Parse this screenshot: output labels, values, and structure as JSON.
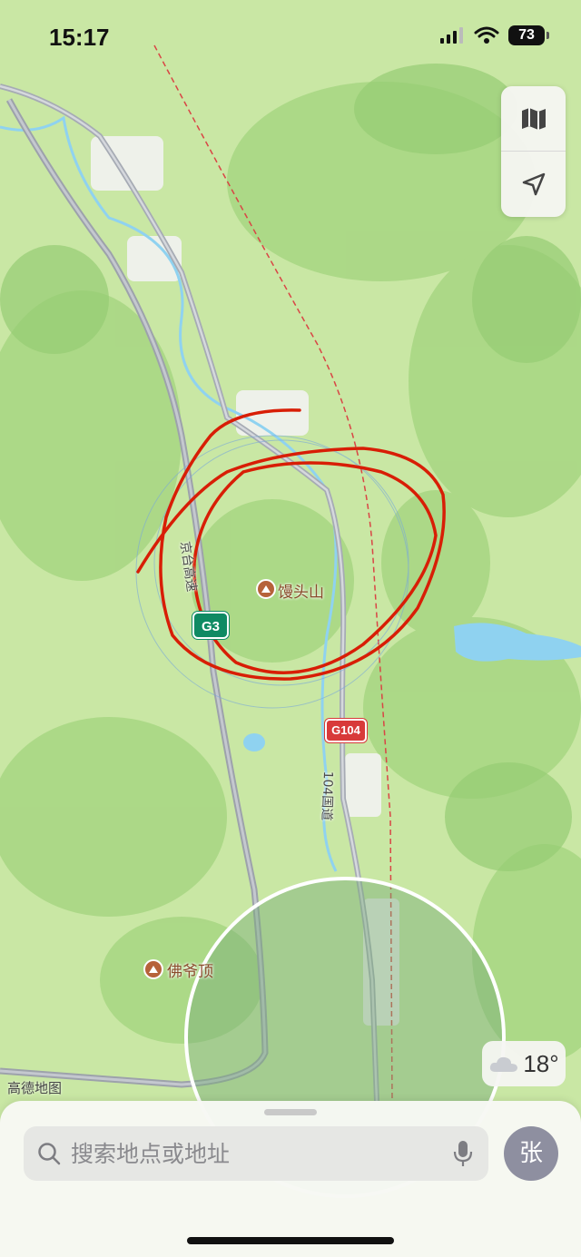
{
  "status_bar": {
    "time": "15:17",
    "battery": "73"
  },
  "map": {
    "labels": {
      "mantou_shan": "馒头山",
      "foye_ding": "佛爷顶",
      "expressway_name": "京台高速",
      "national_road_name": "104国道"
    },
    "shields": {
      "g3": "G3",
      "g104": "G104"
    },
    "watermark": "高德地图"
  },
  "weather": {
    "temperature": "18°",
    "icon": "cloud-icon"
  },
  "search": {
    "placeholder": "搜索地点或地址"
  },
  "avatar": {
    "initial": "张"
  },
  "controls": [
    {
      "name": "map-mode-button",
      "icon": "map-icon"
    },
    {
      "name": "locate-button",
      "icon": "location-arrow-icon"
    }
  ],
  "colors": {
    "land": "#c9e7a4",
    "forest": "#a9d784",
    "water": "#8fd2f0",
    "highway": "#9da2ab",
    "annotation": "#d81e06",
    "railway": "#d94545"
  }
}
